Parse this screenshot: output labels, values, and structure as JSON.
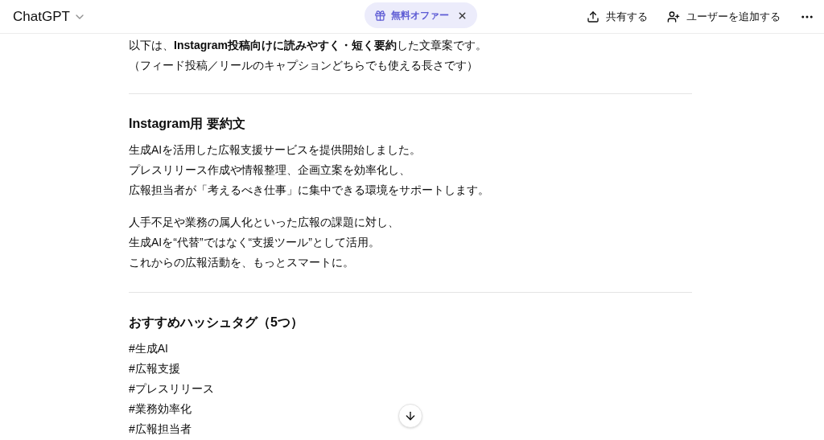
{
  "header": {
    "title": "ChatGPT",
    "offer": "無料オファー",
    "share": "共有する",
    "add_user": "ユーザーを追加する"
  },
  "intro": [
    "以下は、**Instagram投稿向けに読みやすく・短く要約**した文章案です。",
    "（フィード投稿／リールのキャプションどちらでも使える長さです）"
  ],
  "sections": [
    {
      "heading": "Instagram用 要約文",
      "paragraphs": [
        [
          "生成AIを活用した広報支援サービスを提供開始しました。",
          "プレスリリース作成や情報整理、企画立案を効率化し、",
          "広報担当者が「考えるべき仕事」に集中できる環境をサポートします。"
        ],
        [
          "人手不足や業務の属人化といった広報の課題に対し、",
          "生成AIを“代替”ではなく“支援ツール”として活用。",
          "これからの広報活動を、もっとスマートに。"
        ]
      ]
    },
    {
      "heading": "おすすめハッシュタグ（5つ）",
      "paragraphs": [
        [
          "#生成AI",
          "#広報支援",
          "#プレスリリース",
          "#業務効率化",
          "#広報担当者"
        ]
      ]
    }
  ]
}
